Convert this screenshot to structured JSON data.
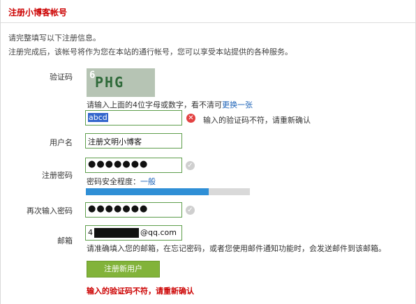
{
  "header": {
    "title": "注册小博客帐号"
  },
  "intro": {
    "line1": "请完整填写以下注册信息。",
    "line2": "注册完成后，该帐号将作为您在本站的通行帐号，您可以享受本站提供的各种服务。"
  },
  "captcha": {
    "label": "验证码",
    "image_text": "PHG",
    "image_digit": "6",
    "hint_prefix": "请输入上面的4位字母或数字，看不清可",
    "refresh_link": "更换一张",
    "value": "abcd",
    "error_text": "输入的验证码不符，请重新确认"
  },
  "username": {
    "label": "用户名",
    "value": "注册文明小博客"
  },
  "password": {
    "label": "注册密码",
    "masked_value": "●●●●●●●",
    "strength_label": "密码安全程度：",
    "strength_value": "一般",
    "strength_fraction": 0.75
  },
  "confirm_password": {
    "label": "再次输入密码",
    "masked_value": "●●●●●●●"
  },
  "email": {
    "label": "邮箱",
    "value_prefix": "4",
    "value_suffix": "@qq.com",
    "hint": "请准确填入您的邮箱，在忘记密码，或者您使用邮件通知功能时，会发送邮件到该邮箱。"
  },
  "submit_label": "注册新用户",
  "form_error": "输入的验证码不符，请重新确认",
  "colors": {
    "accent_red": "#cc0000",
    "button_green": "#82b33a",
    "field_border": "#5e9e4c",
    "meter_fill": "#2f8fd6",
    "link_blue": "#1d63b8"
  },
  "icons": {
    "error": "error-x-icon",
    "valid": "check-icon"
  }
}
